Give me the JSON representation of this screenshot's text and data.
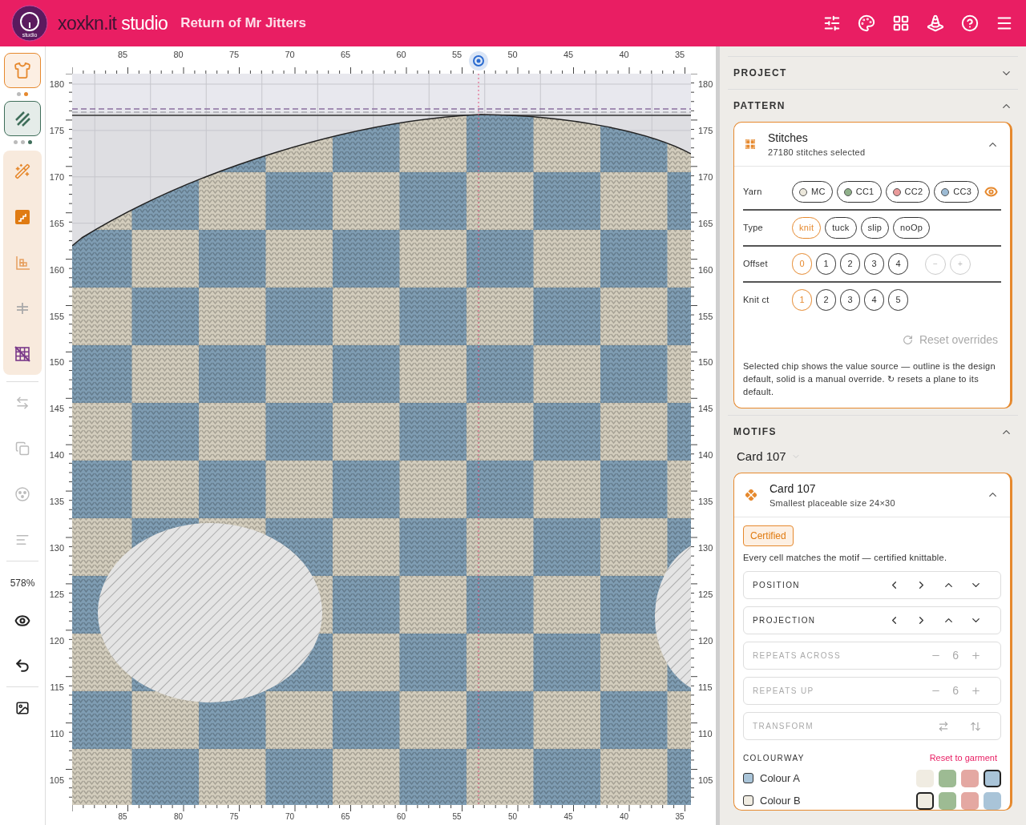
{
  "header": {
    "logo_text": "studio",
    "brand_dark": "xoxkn.it",
    "brand_light": "studio",
    "project_title": "Return of Mr Jitters"
  },
  "left_toolbar": {
    "modes": [
      {
        "selected": true,
        "color": "#e6892e",
        "dots": [
          {
            "selected": false
          },
          {
            "selected": true
          }
        ]
      },
      {
        "selected": true,
        "color": "#3f6e5a",
        "dots": [
          {
            "selected": false
          },
          {
            "selected": false
          },
          {
            "selected": true
          }
        ]
      }
    ],
    "tools": [
      {
        "disabled": false
      },
      {
        "disabled": false
      },
      {
        "disabled": false
      },
      {
        "disabled": true
      },
      {
        "disabled": false
      }
    ],
    "actions": [
      {
        "disabled": true
      },
      {
        "disabled": true
      },
      {
        "disabled": true
      },
      {
        "disabled": true
      }
    ],
    "zoom": "578%"
  },
  "canvas": {
    "top_ruler": [
      "85",
      "80",
      "75",
      "70",
      "65",
      "60",
      "55",
      "50",
      "45",
      "40",
      "35"
    ],
    "bottom_ruler": [
      "85",
      "80",
      "75",
      "70",
      "65",
      "60",
      "55",
      "50",
      "45",
      "40",
      "35"
    ],
    "left_ruler": [
      "180",
      "175",
      "170",
      "165",
      "160",
      "155",
      "150",
      "145",
      "140",
      "135",
      "130",
      "125",
      "120",
      "115",
      "110",
      "105"
    ],
    "right_ruler": [
      "180",
      "175",
      "170",
      "165",
      "160",
      "155",
      "150",
      "145",
      "140",
      "135",
      "130",
      "125",
      "120",
      "115",
      "110",
      "105"
    ]
  },
  "project": {
    "title": "PROJECT",
    "expanded": false
  },
  "pattern": {
    "title": "PATTERN",
    "expanded": true,
    "card": {
      "title": "Stitches",
      "subtitle": "27180 stitches selected",
      "expanded": true,
      "rows": [
        {
          "label": "Yarn",
          "kind": "yarn",
          "chips": [
            {
              "label": "MC",
              "color": "#ece8dc",
              "selected": false
            },
            {
              "label": "CC1",
              "color": "#8fb08a",
              "selected": false
            },
            {
              "label": "CC2",
              "color": "#e99a9a",
              "selected": false
            },
            {
              "label": "CC3",
              "color": "#9dbbd4",
              "selected": false
            }
          ]
        },
        {
          "label": "Type",
          "kind": "pill",
          "chips": [
            {
              "label": "knit",
              "selected": true
            },
            {
              "label": "tuck",
              "selected": false
            },
            {
              "label": "slip",
              "selected": false
            },
            {
              "label": "noOp",
              "selected": false
            }
          ]
        },
        {
          "label": "Offset",
          "kind": "round",
          "chips": [
            {
              "label": "0",
              "selected": true
            },
            {
              "label": "1",
              "selected": false
            },
            {
              "label": "2",
              "selected": false
            },
            {
              "label": "3",
              "selected": false
            },
            {
              "label": "4",
              "selected": false
            }
          ],
          "steppers": [
            {
              "label": "−",
              "disabled": true
            },
            {
              "label": "+",
              "disabled": true
            }
          ]
        },
        {
          "label": "Knit ct",
          "kind": "round",
          "chips": [
            {
              "label": "1",
              "selected": true
            },
            {
              "label": "2",
              "selected": false
            },
            {
              "label": "3",
              "selected": false
            },
            {
              "label": "4",
              "selected": false
            },
            {
              "label": "5",
              "selected": false
            }
          ]
        }
      ],
      "reset": "Reset overrides",
      "note": "Selected chip shows the value source — outline is the design default, solid is a manual override. ↻ resets a plane to its default."
    }
  },
  "motifs": {
    "title": "MOTIFS",
    "expanded": true,
    "selector": "Card 107",
    "card": {
      "title": "Card 107",
      "subtitle": "Smallest placeable size 24×30",
      "expanded": true,
      "badge": "Certified",
      "message": "Every cell matches the motif — certified knittable.",
      "controls": [
        {
          "kind": "nudge",
          "label": "POSITION",
          "disabled": false
        },
        {
          "kind": "nudge",
          "label": "PROJECTION",
          "disabled": false
        },
        {
          "kind": "stepper",
          "label": "REPEATS ACROSS",
          "value": "6",
          "disabled": true
        },
        {
          "kind": "stepper",
          "label": "REPEATS UP",
          "value": "6",
          "disabled": true
        },
        {
          "kind": "transform",
          "label": "TRANSFORM",
          "disabled": true
        }
      ],
      "colourway": {
        "title": "COLOURWAY",
        "reset": "Reset to garment",
        "colours": [
          {
            "label": "Colour A",
            "color": "#a9c4d8",
            "swatches": [
              {
                "color": "#f0ece2",
                "selected": false
              },
              {
                "color": "#9dbb93",
                "selected": false
              },
              {
                "color": "#e4a8a2",
                "selected": false
              },
              {
                "color": "#a9c4d8",
                "selected": true
              }
            ]
          },
          {
            "label": "Colour B",
            "color": "#f0ece2",
            "swatches": [
              {
                "color": "#f0ece2",
                "selected": true
              },
              {
                "color": "#9dbb93",
                "selected": false
              },
              {
                "color": "#e4a8a2",
                "selected": false
              },
              {
                "color": "#a9c4d8",
                "selected": false
              }
            ]
          }
        ]
      }
    }
  }
}
